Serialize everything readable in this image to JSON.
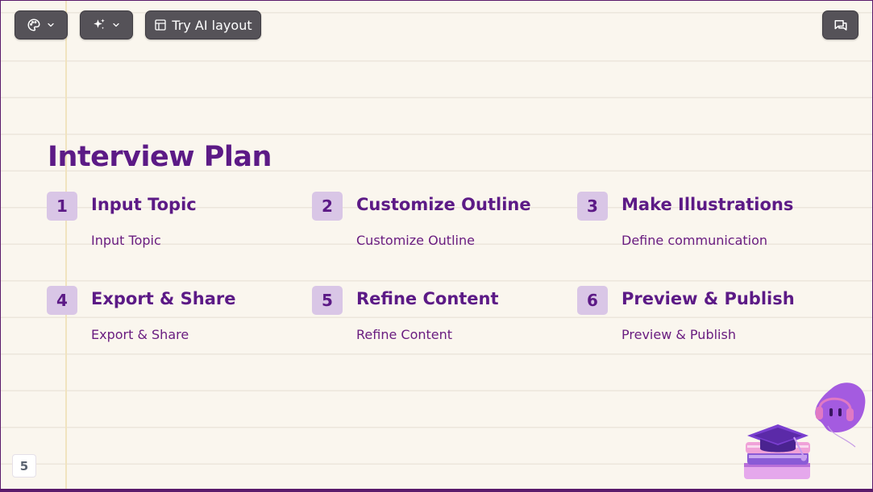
{
  "toolbar": {
    "theme_icon": "palette-icon",
    "ai_icon": "sparkles-icon",
    "dropdown_icon": "chevron-down-icon",
    "layout_icon": "layout-icon",
    "try_ai_layout_label": "Try AI layout",
    "comment_icon": "comment-icon"
  },
  "slide": {
    "title": "Interview Plan",
    "page_number": "5",
    "steps": [
      {
        "number": "1",
        "title": "Input Topic",
        "description": "Input Topic"
      },
      {
        "number": "2",
        "title": "Customize Outline",
        "description": "Customize Outline"
      },
      {
        "number": "3",
        "title": "Make Illustrations",
        "description": "Define communication"
      },
      {
        "number": "4",
        "title": "Export & Share",
        "description": "Export & Share"
      },
      {
        "number": "5",
        "title": "Refine Content",
        "description": "Refine Content"
      },
      {
        "number": "6",
        "title": "Preview & Publish",
        "description": "Preview & Publish"
      }
    ]
  },
  "colors": {
    "accent": "#5c1a86",
    "badge_bg": "#d9c6e6",
    "paper": "#faf6ee",
    "frame": "#5a1a6b",
    "toolbar_button": "#555258"
  }
}
